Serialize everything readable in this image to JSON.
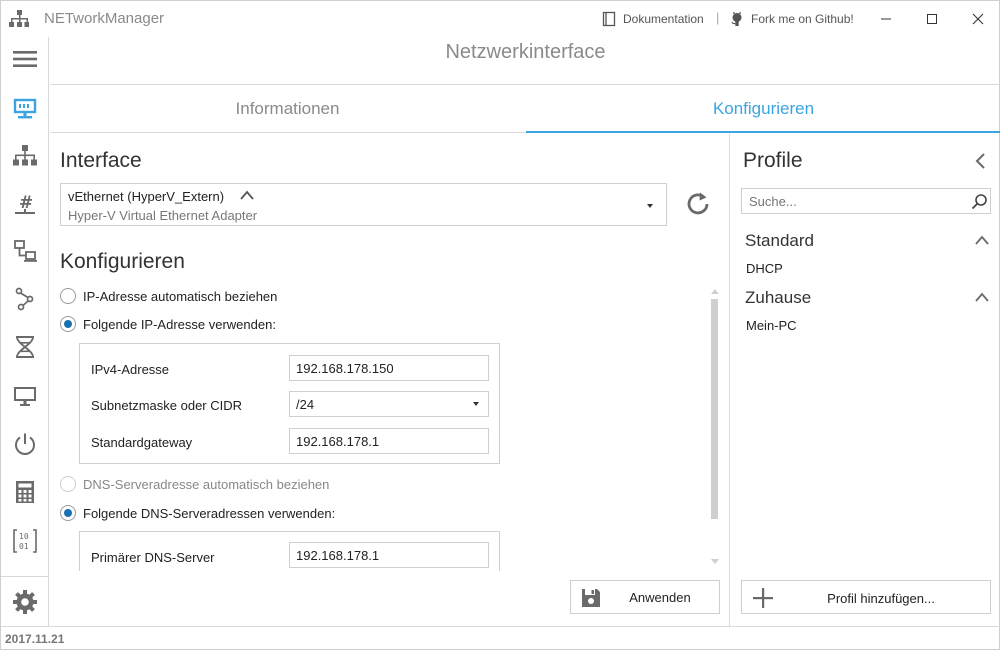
{
  "app": {
    "title": "NETworkManager",
    "version": "2017.11.21"
  },
  "titlebar": {
    "docs_label": "Dokumentation",
    "separator": "|",
    "github_label": "Fork me on Github!",
    "docs_icon": "book-icon",
    "github_icon": "github-icon"
  },
  "sidebar": {
    "items": [
      {
        "icon": "hamburger-menu-icon"
      },
      {
        "icon": "network-interface-icon",
        "active": true
      },
      {
        "icon": "network-tree-icon"
      },
      {
        "icon": "hashtag-icon"
      },
      {
        "icon": "pc-network-icon"
      },
      {
        "icon": "route-icon"
      },
      {
        "icon": "dna-icon"
      },
      {
        "icon": "monitor-icon"
      },
      {
        "icon": "power-icon"
      },
      {
        "icon": "calculator-icon"
      },
      {
        "icon": "binary-icon"
      }
    ],
    "settings_icon": "gear-icon"
  },
  "page": {
    "title": "Netzwerkinterface"
  },
  "tabs": [
    {
      "label": "Informationen",
      "active": false
    },
    {
      "label": "Konfigurieren",
      "active": true
    }
  ],
  "interface": {
    "heading": "Interface",
    "name": "vEthernet (HyperV_Extern)",
    "description": "Hyper-V Virtual Ethernet Adapter"
  },
  "configure": {
    "heading": "Konfigurieren",
    "ip_auto_label": "IP-Adresse automatisch beziehen",
    "ip_manual_label": "Folgende IP-Adresse verwenden:",
    "ip_mode": "manual",
    "fields": {
      "ipv4_label": "IPv4-Adresse",
      "ipv4_value": "192.168.178.150",
      "subnet_label": "Subnetzmaske oder CIDR",
      "subnet_value": "/24",
      "gateway_label": "Standardgateway",
      "gateway_value": "192.168.178.1"
    },
    "dns_auto_label": "DNS-Serveradresse automatisch beziehen",
    "dns_manual_label": "Folgende DNS-Serveradressen verwenden:",
    "dns_mode": "manual",
    "dns_primary_label": "Primärer DNS-Server",
    "dns_primary_value": "192.168.178.1",
    "apply_label": "Anwenden"
  },
  "profiles": {
    "heading": "Profile",
    "search_placeholder": "Suche...",
    "groups": [
      {
        "name": "Standard",
        "items": [
          "DHCP"
        ]
      },
      {
        "name": "Zuhause",
        "items": [
          "Mein-PC"
        ]
      }
    ],
    "add_label": "Profil hinzufügen..."
  },
  "colors": {
    "accent": "#3aa5e0",
    "radio_checked": "#1a6fb0",
    "icon_gray": "#6a6a6a"
  }
}
